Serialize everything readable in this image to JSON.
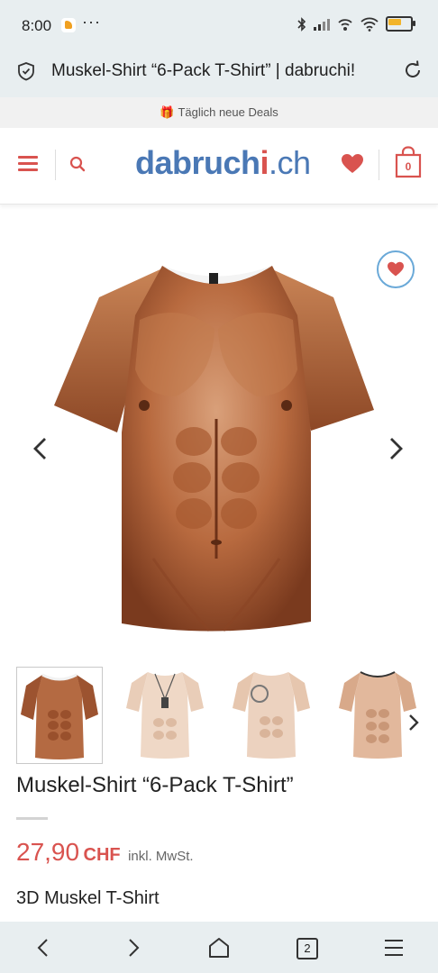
{
  "status_bar": {
    "time": "8:00",
    "dots": "···"
  },
  "browser": {
    "page_title": "Muskel-Shirt “6-Pack T-Shirt” | dabruchi!",
    "tab_count": "2"
  },
  "promo": {
    "text": "Täglich neue Deals"
  },
  "header": {
    "logo_part1": "dabruch",
    "logo_part2": "i",
    "logo_part3": ".ch",
    "cart_count": "0"
  },
  "product": {
    "title": "Muskel-Shirt “6-Pack T-Shirt”",
    "price": "27,90",
    "currency": "CHF",
    "tax_note": "inkl. MwSt.",
    "subtitle": "3D Muskel T-Shirt"
  },
  "colors": {
    "accent": "#d9534f",
    "logo_blue": "#4a78b5",
    "chrome_bg": "#e8eef0"
  }
}
